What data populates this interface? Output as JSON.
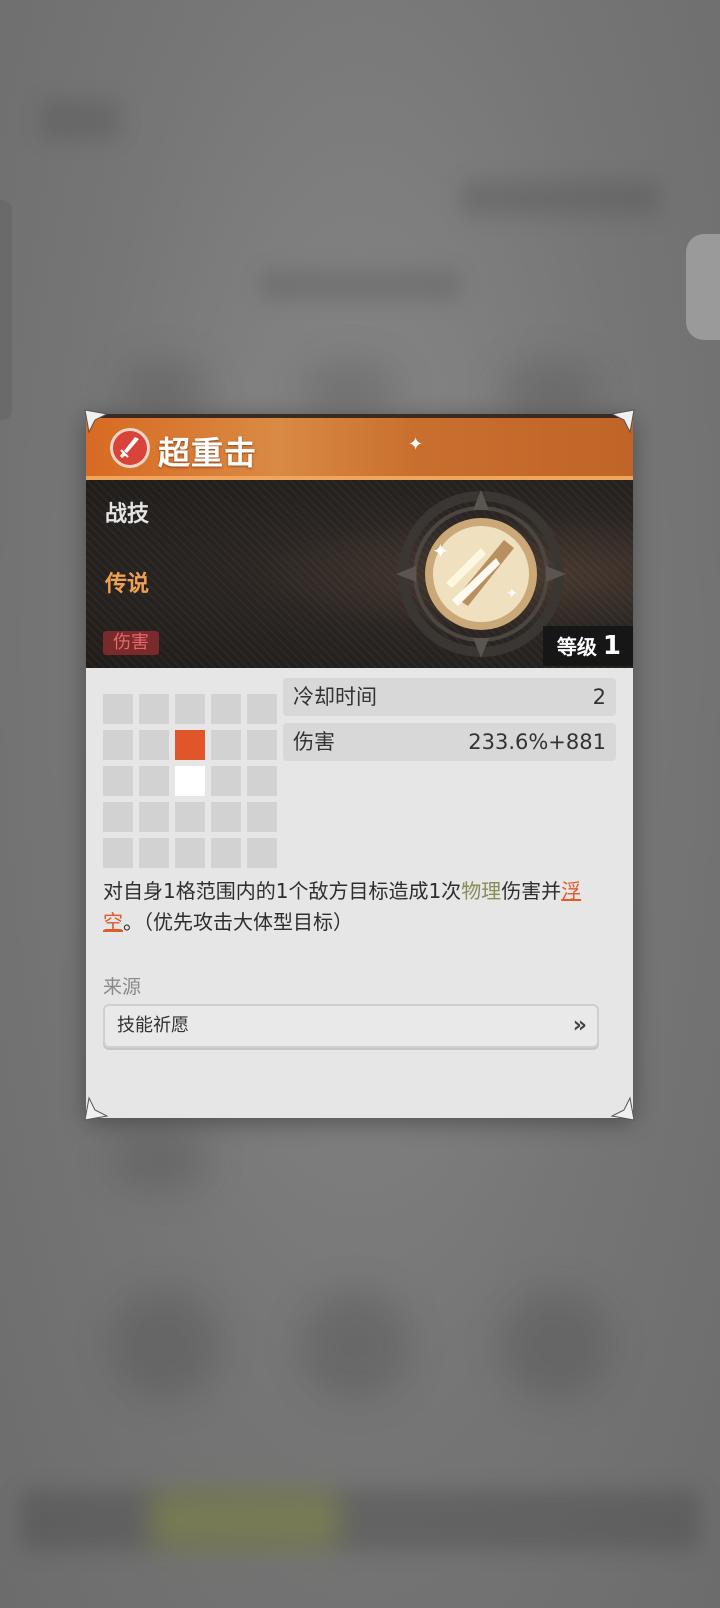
{
  "skill": {
    "title": "超重击",
    "type": "战技",
    "rarity": "传说",
    "tag": "伤害",
    "level_label": "等级",
    "level_value": "1"
  },
  "stats": [
    {
      "label": "冷却时间",
      "value": "2"
    },
    {
      "label": "伤害",
      "value": "233.6%+881"
    }
  ],
  "range_grid": {
    "rows": 5,
    "cols": 5,
    "target_cells": [
      [
        1,
        2
      ]
    ],
    "self_cells": [
      [
        2,
        2
      ]
    ]
  },
  "description": {
    "part1": "对自身1格范围内的1个敌方目标造成1次",
    "physical": "物理",
    "part2": "伤害并",
    "float": "浮空",
    "part3": "。（优先攻击大体型目标）"
  },
  "source": {
    "label": "来源",
    "button_label": "技能祈愿",
    "chevron": "»"
  },
  "colors": {
    "header_orange": "#d86a22",
    "target_cell": "#e0562a",
    "rarity_orange": "#f0a050",
    "tag_red": "#e26a6a"
  },
  "icons": [
    "sword-icon",
    "skill-emblem-icon",
    "sparkle-icon",
    "double-chevron-icon",
    "corner-ornament-icon"
  ]
}
